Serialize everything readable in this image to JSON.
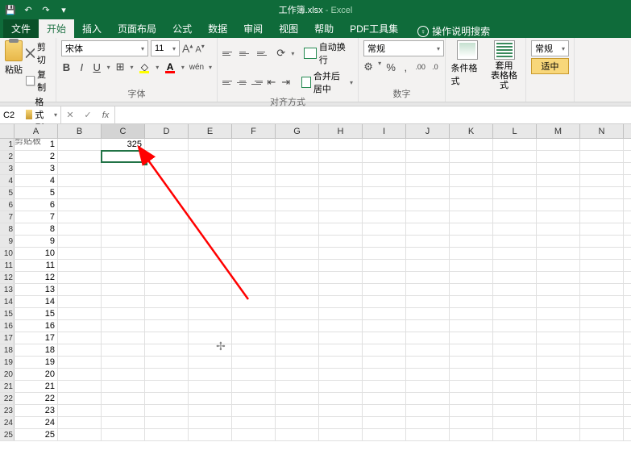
{
  "titlebar": {
    "filename": "工作簿.xlsx",
    "appname": "Excel"
  },
  "tabs": {
    "file": "文件",
    "home": "开始",
    "insert": "插入",
    "layout": "页面布局",
    "formulas": "公式",
    "data": "数据",
    "review": "审阅",
    "view": "视图",
    "help": "帮助",
    "pdf": "PDF工具集",
    "tellme": "操作说明搜索"
  },
  "ribbon": {
    "clipboard": {
      "label": "剪贴板",
      "paste": "粘贴",
      "cut": "剪切",
      "copy": "复制",
      "painter": "格式刷"
    },
    "font": {
      "label": "字体",
      "name": "宋体",
      "size": "11",
      "bold": "B",
      "italic": "I",
      "underline": "U",
      "grow": "A",
      "shrink": "A"
    },
    "align": {
      "label": "对齐方式",
      "wrap": "自动换行",
      "merge": "合并后居中"
    },
    "number": {
      "label": "数字",
      "format": "常规"
    },
    "styles": {
      "cond": "条件格式",
      "table": "套用\n表格格式"
    },
    "cells": {
      "format": "常规",
      "fit": "适中"
    }
  },
  "namebox": "C2",
  "columns": [
    "A",
    "B",
    "C",
    "D",
    "E",
    "F",
    "G",
    "H",
    "I",
    "J",
    "K",
    "L",
    "M",
    "N"
  ],
  "rowcount": 25,
  "colA_values": [
    "1",
    "2",
    "3",
    "4",
    "5",
    "6",
    "7",
    "8",
    "9",
    "10",
    "11",
    "12",
    "13",
    "14",
    "15",
    "16",
    "17",
    "18",
    "19",
    "20",
    "21",
    "22",
    "23",
    "24",
    "25"
  ],
  "cell_C1": "325",
  "selected_col": "C",
  "selected_row": 2
}
